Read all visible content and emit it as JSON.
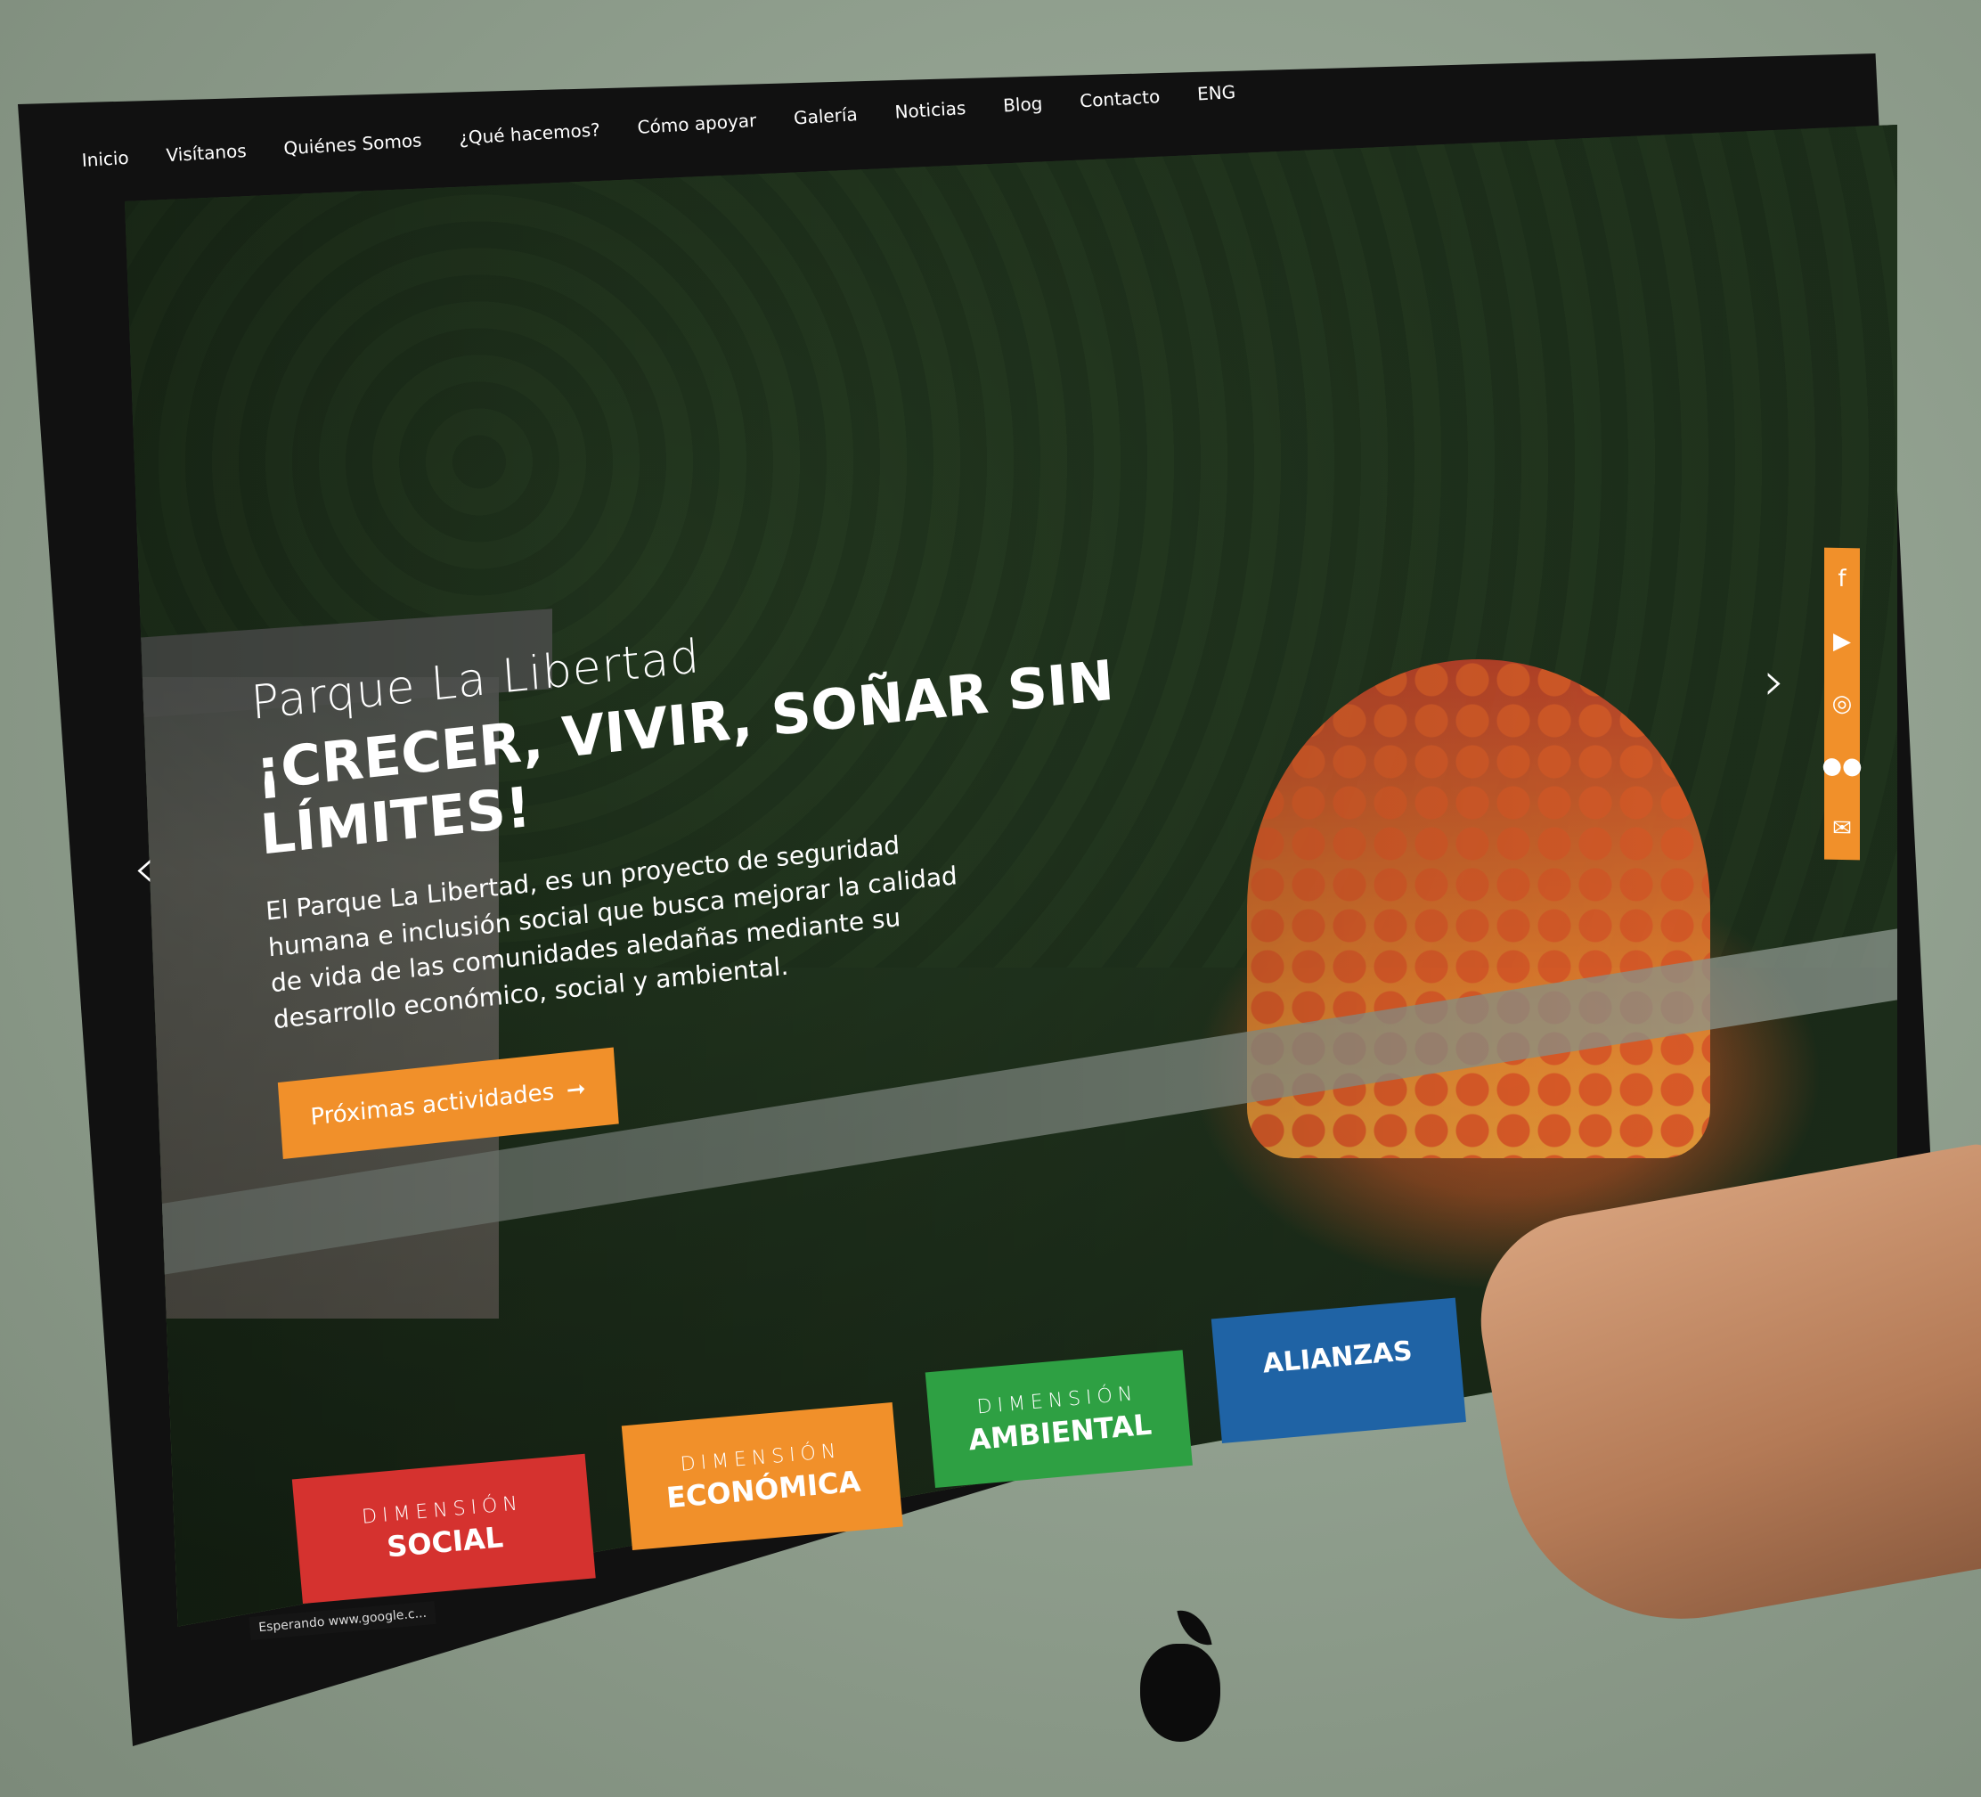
{
  "nav": {
    "items": [
      "Inicio",
      "Visítanos",
      "Quiénes Somos",
      "¿Qué hacemos?",
      "Cómo apoyar",
      "Galería",
      "Noticias",
      "Blog",
      "Contacto",
      "ENG"
    ]
  },
  "hero": {
    "subtitle": "Parque La Libertad",
    "headline": "¡CRECER, VIVIR, SOÑAR SIN LÍMITES!",
    "description": "El Parque La Libertad, es un proyecto de seguridad humana e inclusión social que busca mejorar la calidad de vida de las comunidades aledañas mediante su desarrollo económico, social y ambiental.",
    "cta_label": "Próximas actividades",
    "cta_arrow": "➞"
  },
  "carousel": {
    "prev_icon": "‹",
    "next_icon": "›"
  },
  "social": {
    "icons": [
      "facebook-icon",
      "youtube-icon",
      "instagram-icon",
      "flickr-icon",
      "mail-icon"
    ],
    "glyphs": [
      "f",
      "▶",
      "◎",
      "●●",
      "✉"
    ]
  },
  "tiles": [
    {
      "kicker": "DIMENSIÓN",
      "name": "SOCIAL",
      "color": "#d5322f"
    },
    {
      "kicker": "DIMENSIÓN",
      "name": "ECONÓMICA",
      "color": "#f1902a"
    },
    {
      "kicker": "DIMENSIÓN",
      "name": "AMBIENTAL",
      "color": "#2ea043"
    },
    {
      "kicker": "",
      "name": "ALIANZAS",
      "color": "#1f63a5"
    }
  ],
  "status_bar": "Esperando www.google.c...",
  "colors": {
    "accent_orange": "#f1902a",
    "social_red": "#d5322f",
    "ambiental_green": "#2ea043",
    "alianzas_blue": "#1f63a5"
  }
}
